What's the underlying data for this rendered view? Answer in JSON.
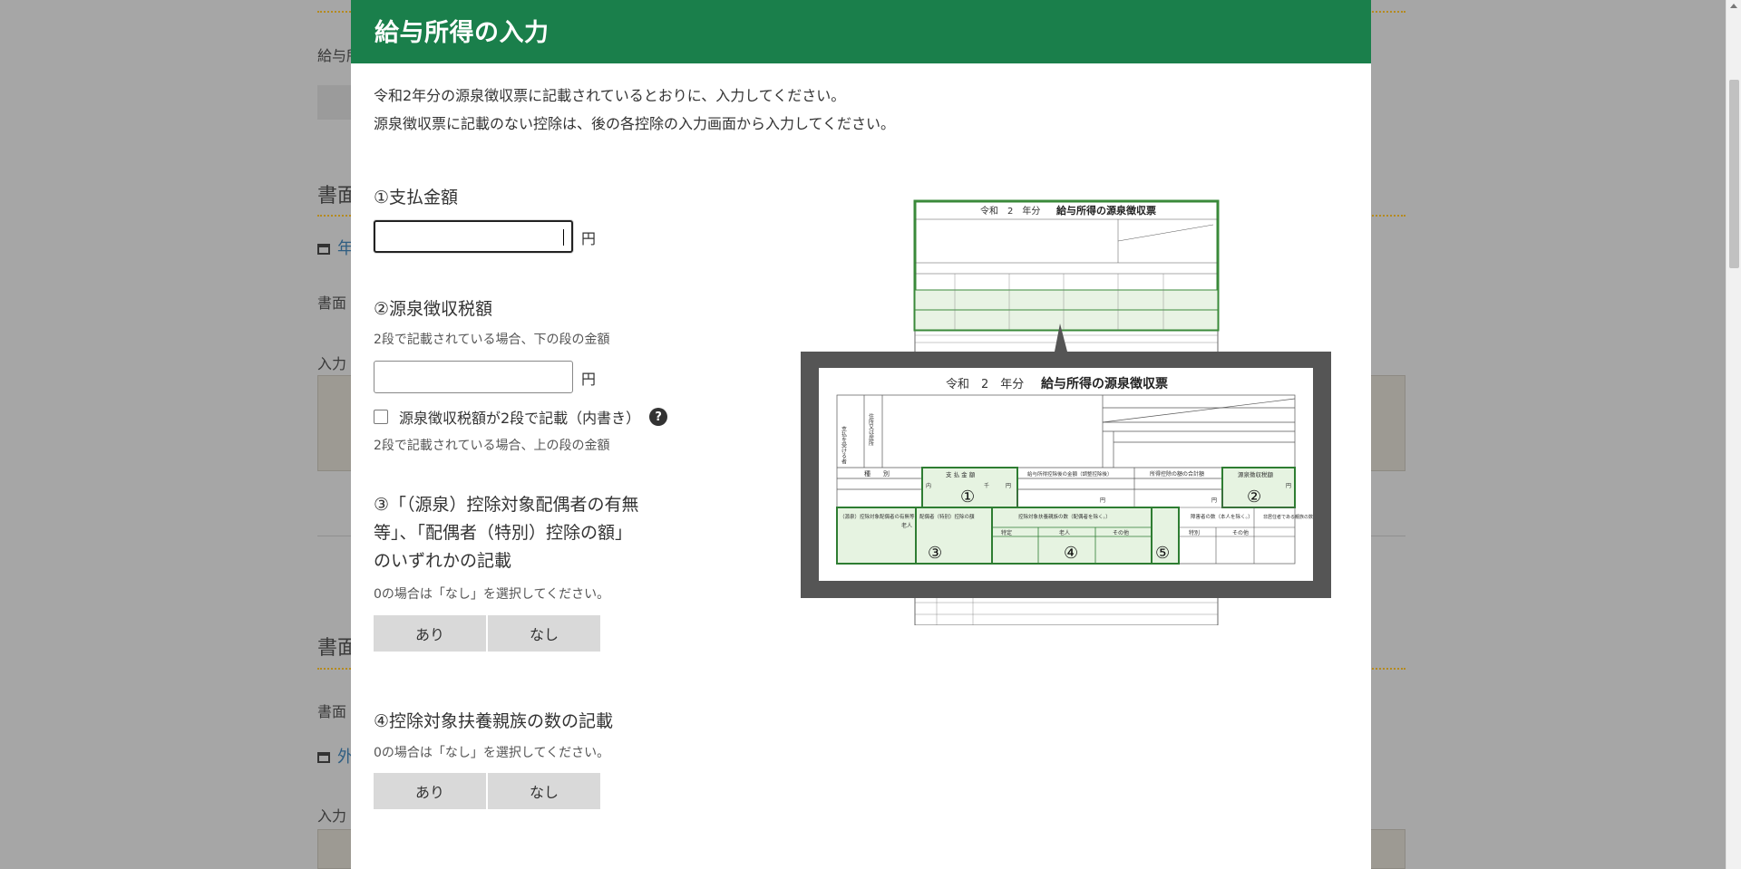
{
  "background": {
    "label_1": "給与所",
    "heading_1": "書面",
    "link_1": "年",
    "label_2": "書面",
    "label_3": "入力",
    "heading_2": "書面",
    "label_4": "書面",
    "link_2": "外",
    "label_5": "入力"
  },
  "modal": {
    "title": "給与所得の入力",
    "intro_line1": "令和2年分の源泉徴収票に記載されているとおりに、入力してください。",
    "intro_line2": "源泉徴収票に記載のない控除は、後の各控除の入力画面から入力してください。",
    "field1": {
      "label": "①支払金額",
      "value": "",
      "unit": "円"
    },
    "field2": {
      "label": "②源泉徴収税額",
      "hint": "2段で記載されている場合、下の段の金額",
      "value": "",
      "unit": "円",
      "checkbox_label": "源泉徴収税額が2段で記載（内書き）",
      "help": "?",
      "checkbox_hint": "2段で記載されている場合、上の段の金額"
    },
    "field3": {
      "label_line1": "③「（源泉）控除対象配偶者の有無",
      "label_line2": "等」、「配偶者（特別）控除の額」",
      "label_line3": "のいずれかの記載",
      "hint": "0の場合は「なし」を選択してください。",
      "option_yes": "あり",
      "option_no": "なし"
    },
    "field4": {
      "label": "④控除対象扶養親族の数の記載",
      "hint": "0の場合は「なし」を選択してください。",
      "option_yes": "あり",
      "option_no": "なし"
    },
    "illustration": {
      "small_title_year": "令和　2　年分",
      "small_title": "給与所得の源泉徴収票",
      "big_title_year": "令和　2　年分",
      "big_title": "給与所得の源泉徴収票",
      "mark1": "①",
      "mark2": "②",
      "mark3": "③",
      "mark4": "④",
      "mark5": "⑤",
      "col_shubetsu": "種　　別",
      "col_shiharai": "支 払 金 額",
      "col_kyuyo": "給与所得控除後の金額（調整控除後）",
      "col_kojo_gokei": "所得控除の額の合計額",
      "col_gensen": "源泉徴収税額",
      "col_haigusha": "（源泉）控除対象配偶者の有無等",
      "col_haigusha_kojo": "配偶者（特別）控除の額",
      "col_fuyo": "控除対象扶養親族の数（配偶者を除く。）",
      "col_shogaisha": "障害者の数（本人を除く。）",
      "col_hijukyo": "非居住者である親族の数",
      "label_shiharai_person": "支払を受ける者",
      "label_jusho": "住所又は居所",
      "unit_sen": "千",
      "unit_en": "円",
      "unit_nin": "人",
      "label_tokutei": "特定",
      "label_rojin": "老人",
      "label_sonota": "その他",
      "label_tokubetsu": "特別",
      "label_uchi": "内"
    }
  }
}
